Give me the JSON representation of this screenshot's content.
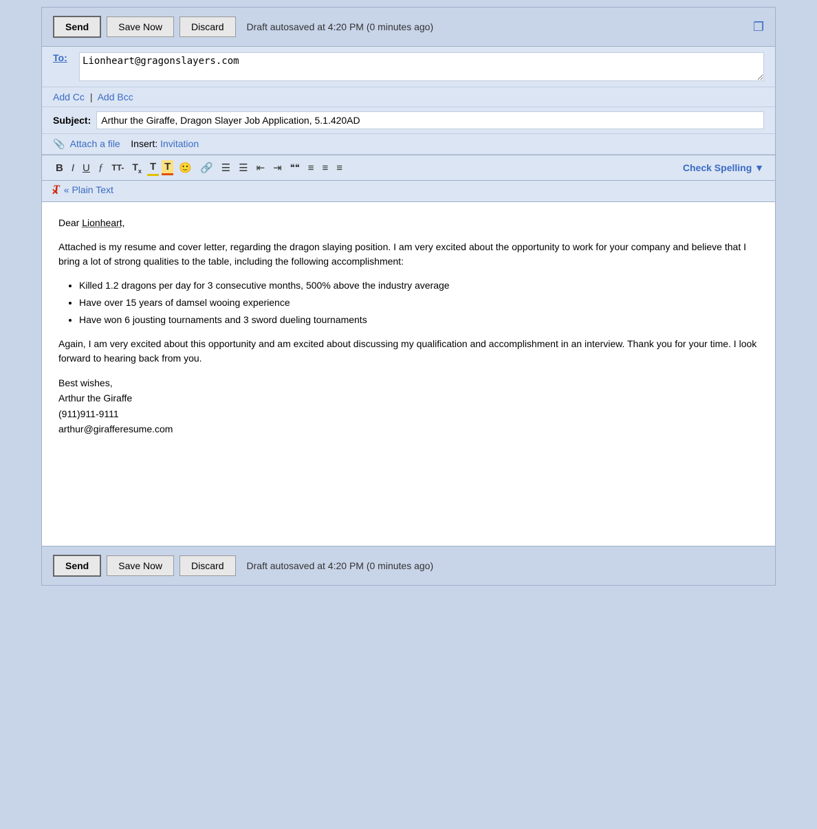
{
  "toolbar": {
    "send_label": "Send",
    "save_now_label": "Save Now",
    "discard_label": "Discard",
    "autosave_text": "Draft autosaved at 4:20 PM (0 minutes ago)",
    "expand_icon": "⊡",
    "check_spelling_label": "Check Spelling ▼"
  },
  "header": {
    "to_label": "To:",
    "to_value": "Lionheart@gragonslayers.com",
    "add_cc_label": "Add Cc",
    "separator": "|",
    "add_bcc_label": "Add Bcc",
    "subject_label": "Subject:",
    "subject_value": "Arthur the Giraffe, Dragon Slayer Job Application, 5.1.420AD",
    "attach_label": "Attach a file",
    "insert_label": "Insert:",
    "invitation_label": "Invitation"
  },
  "formatting": {
    "bold": "B",
    "italic": "I",
    "underline": "U",
    "font_face": "𝒻",
    "font_size_increase": "TT-",
    "font_size": "T",
    "font_color": "T",
    "bg_color": "T",
    "emoticon": "☺",
    "link": "🔗",
    "ordered_list": "☰",
    "unordered_list": "☰",
    "indent_less": "◁",
    "indent_more": "▷",
    "blockquote": "❝❝",
    "align_left": "≡",
    "align_center": "≡",
    "align_right": "≡",
    "plain_text_icon": "T",
    "plain_text_label": "« Plain Text"
  },
  "body": {
    "greeting": "Dear Lionheart,",
    "para1": "Attached is my resume and cover letter, regarding the dragon slaying position.  I am very excited about the opportunity to work for your company and believe that I bring a lot of strong qualities to the table, including the following accomplishment:",
    "bullet1": "Killed 1.2 dragons per day for 3 consecutive months, 500% above the industry average",
    "bullet2": "Have over 15 years of damsel wooing experience",
    "bullet3": "Have won 6 jousting tournaments and 3 sword dueling tournaments",
    "para2": "Again, I am very excited about this opportunity and am excited about discussing my qualification and accomplishment in an interview.  Thank you for your time.  I look forward to hearing back from you.",
    "sig_line1": "Best wishes,",
    "sig_line2": "Arthur the Giraffe",
    "sig_line3": "(911)911-9111",
    "sig_line4": "arthur@girafferesume.com"
  }
}
